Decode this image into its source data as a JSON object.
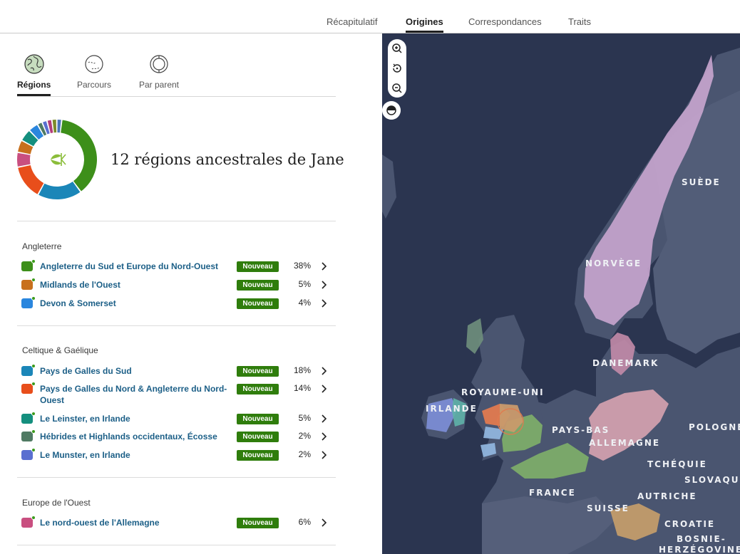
{
  "topnav": {
    "tabs": [
      {
        "label": "Récapitulatif",
        "active": false
      },
      {
        "label": "Origines",
        "active": true
      },
      {
        "label": "Correspondances",
        "active": false
      },
      {
        "label": "Traits",
        "active": false
      }
    ]
  },
  "subtabs": [
    {
      "label": "Régions",
      "icon": "globe-icon",
      "active": true
    },
    {
      "label": "Parcours",
      "icon": "journey-circle-icon",
      "active": false
    },
    {
      "label": "Par parent",
      "icon": "parent-rings-icon",
      "active": false
    }
  ],
  "summary": {
    "title": "12 régions ancestrales de Jane",
    "center_icon": "ancestry-leaf-icon"
  },
  "groups": [
    {
      "title": "Angleterre",
      "regions": [
        {
          "name": "Angleterre du Sud et Europe du Nord-Ouest",
          "badge": "Nouveau",
          "percent": "38%",
          "color": "#3d8f1a"
        },
        {
          "name": "Midlands de l'Ouest",
          "badge": "Nouveau",
          "percent": "5%",
          "color": "#c8701d"
        },
        {
          "name": "Devon & Somerset",
          "badge": "Nouveau",
          "percent": "4%",
          "color": "#2a86de"
        }
      ]
    },
    {
      "title": "Celtique & Gaélique",
      "regions": [
        {
          "name": "Pays de Galles du Sud",
          "badge": "Nouveau",
          "percent": "18%",
          "color": "#1b86b8"
        },
        {
          "name": "Pays de Galles du Nord & Angleterre du Nord-Ouest",
          "badge": "Nouveau",
          "percent": "14%",
          "color": "#e84e1b"
        },
        {
          "name": "Le Leinster, en Irlande",
          "badge": "Nouveau",
          "percent": "5%",
          "color": "#148f7e"
        },
        {
          "name": "Hébrides et Highlands occidentaux, Écosse",
          "badge": "Nouveau",
          "percent": "2%",
          "color": "#4f7a63"
        },
        {
          "name": "Le Munster, en Irlande",
          "badge": "Nouveau",
          "percent": "2%",
          "color": "#5a6fd0"
        }
      ]
    },
    {
      "title": "Europe de l'Ouest",
      "regions": [
        {
          "name": "Le nord-ouest de l'Allemagne",
          "badge": "Nouveau",
          "percent": "6%",
          "color": "#c94f80"
        }
      ]
    }
  ],
  "chart_data": {
    "type": "pie",
    "categories": [
      "Angleterre du Sud et Europe du Nord-Ouest",
      "Pays de Galles du Sud",
      "Pays de Galles du Nord & Angleterre du Nord-Ouest",
      "Le nord-ouest de l'Allemagne",
      "Midlands de l'Ouest",
      "Le Leinster, en Irlande",
      "Devon & Somerset",
      "Hébrides et Highlands occidentaux, Écosse",
      "Le Munster, en Irlande",
      "",
      "",
      ""
    ],
    "values": [
      38,
      18,
      14,
      6,
      5,
      5,
      4,
      2,
      2,
      2,
      2,
      2
    ],
    "colors": [
      "#3d8f1a",
      "#1b86b8",
      "#e84e1b",
      "#c94f80",
      "#c8701d",
      "#148f7e",
      "#2a86de",
      "#4f7a63",
      "#5a6fd0",
      "#b33c7a",
      "#7c8a2a",
      "#4a74b8"
    ]
  },
  "map": {
    "labels": [
      {
        "text": "SUÈDE"
      },
      {
        "text": "NORVÈGE"
      },
      {
        "text": "DANEMARK"
      },
      {
        "text": "ROYAUME-UNI"
      },
      {
        "text": "IRLANDE"
      },
      {
        "text": "PAYS-BAS"
      },
      {
        "text": "ALLEMAGNE"
      },
      {
        "text": "POLOGNE"
      },
      {
        "text": "TCHÉQUIE"
      },
      {
        "text": "SLOVAQUIE"
      },
      {
        "text": "FRANCE"
      },
      {
        "text": "AUTRICHE"
      },
      {
        "text": "SUISSE"
      },
      {
        "text": "CROATIE"
      },
      {
        "text": "BOSNIE-"
      },
      {
        "text": "HERZÉGOVINE"
      }
    ],
    "controls": [
      "zoom-in-icon",
      "reset-view-icon",
      "zoom-out-icon",
      "contrast-toggle-icon"
    ],
    "colors": {
      "sea": "#2b3550",
      "land": "#4a5570",
      "region_norway": "#c9a6cf",
      "region_england": "#7fb069"
    }
  }
}
